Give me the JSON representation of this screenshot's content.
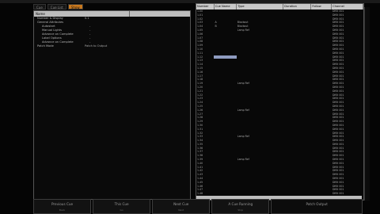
{
  "tabs": [
    "Cue",
    "Cue List",
    "Show"
  ],
  "props": {
    "header_name": "Name",
    "header_value": "",
    "rows": [
      {
        "k": "Number & Display",
        "v": "0.1"
      },
      {
        "k": "General Attributes",
        "v": ""
      },
      {
        "k": "Autostart",
        "v": "-"
      },
      {
        "k": "Manual Lights",
        "v": "-"
      },
      {
        "k": "Advance on Complete",
        "v": "-"
      },
      {
        "k": "Label Options",
        "v": "-"
      },
      {
        "k": "Advance on Complete",
        "v": "-"
      },
      {
        "k": "Patch Mode",
        "v": "Patch to Output"
      }
    ]
  },
  "cuelist": {
    "headers": [
      "Number",
      "Cue Name",
      "Type",
      "Duration",
      "Follow",
      "Channel"
    ],
    "rows": [
      {
        "n": "1.00",
        "a": "",
        "t": "",
        "ch": "DMX 001"
      },
      {
        "n": "1.01",
        "a": "",
        "t": "",
        "ch": "DMX 001"
      },
      {
        "n": "1.02",
        "a": "",
        "t": "",
        "ch": "DMX 001"
      },
      {
        "n": "1.03",
        "a": "A",
        "t": "Blackout",
        "ch": "DMX 001"
      },
      {
        "n": "1.04",
        "a": "B",
        "t": "Blackout",
        "ch": "DMX 001"
      },
      {
        "n": "1.05",
        "a": "",
        "t": "Lamp Ref",
        "ch": "DMX 001"
      },
      {
        "n": "1.06",
        "a": "",
        "t": "",
        "ch": "DMX 001"
      },
      {
        "n": "1.07",
        "a": "",
        "t": "",
        "ch": "DMX 001"
      },
      {
        "n": "1.08",
        "a": "",
        "t": "",
        "ch": "DMX 001"
      },
      {
        "n": "1.09",
        "a": "",
        "t": "",
        "ch": "DMX 001"
      },
      {
        "n": "1.10",
        "a": "",
        "t": "",
        "ch": "DMX 001"
      },
      {
        "n": "1.11",
        "a": "",
        "t": "",
        "ch": "DMX 001"
      },
      {
        "n": "1.12",
        "a": "",
        "t": "",
        "ch": "DMX 001"
      },
      {
        "n": "1.13",
        "a": "",
        "t": "",
        "ch": "DMX 001"
      },
      {
        "n": "1.14",
        "a": "",
        "t": "",
        "ch": "DMX 001"
      },
      {
        "n": "1.15",
        "a": "",
        "t": "",
        "ch": "DMX 001"
      },
      {
        "n": "1.16",
        "a": "",
        "t": "",
        "ch": "DMX 001"
      },
      {
        "n": "1.17",
        "a": "",
        "t": "",
        "ch": "DMX 001"
      },
      {
        "n": "1.18",
        "a": "",
        "t": "",
        "ch": "DMX 001"
      },
      {
        "n": "1.19",
        "a": "",
        "t": "Lamp Ref",
        "ch": "DMX 001"
      },
      {
        "n": "1.20",
        "a": "",
        "t": "",
        "ch": "DMX 001"
      },
      {
        "n": "1.21",
        "a": "",
        "t": "",
        "ch": "DMX 001"
      },
      {
        "n": "1.22",
        "a": "",
        "t": "",
        "ch": "DMX 001"
      },
      {
        "n": "1.23",
        "a": "",
        "t": "",
        "ch": "DMX 001"
      },
      {
        "n": "1.24",
        "a": "",
        "t": "",
        "ch": "DMX 001"
      },
      {
        "n": "1.25",
        "a": "",
        "t": "",
        "ch": "DMX 001"
      },
      {
        "n": "1.26",
        "a": "",
        "t": "Lamp Ref",
        "ch": "DMX 001"
      },
      {
        "n": "1.27",
        "a": "",
        "t": "",
        "ch": "DMX 001"
      },
      {
        "n": "1.28",
        "a": "",
        "t": "",
        "ch": "DMX 001"
      },
      {
        "n": "1.29",
        "a": "",
        "t": "",
        "ch": "DMX 001"
      },
      {
        "n": "1.30",
        "a": "",
        "t": "",
        "ch": "DMX 001"
      },
      {
        "n": "1.31",
        "a": "",
        "t": "",
        "ch": "DMX 001"
      },
      {
        "n": "1.32",
        "a": "",
        "t": "",
        "ch": "DMX 001"
      },
      {
        "n": "1.33",
        "a": "",
        "t": "Lamp Ref",
        "ch": "DMX 001"
      },
      {
        "n": "1.34",
        "a": "",
        "t": "",
        "ch": "DMX 001"
      },
      {
        "n": "1.35",
        "a": "",
        "t": "",
        "ch": "DMX 001"
      },
      {
        "n": "1.36",
        "a": "",
        "t": "",
        "ch": "DMX 001"
      },
      {
        "n": "1.37",
        "a": "",
        "t": "",
        "ch": "DMX 001"
      },
      {
        "n": "1.38",
        "a": "",
        "t": "",
        "ch": "DMX 001"
      },
      {
        "n": "1.39",
        "a": "",
        "t": "Lamp Ref",
        "ch": "DMX 001"
      },
      {
        "n": "1.40",
        "a": "",
        "t": "",
        "ch": "DMX 001"
      },
      {
        "n": "1.41",
        "a": "",
        "t": "",
        "ch": "DMX 001"
      },
      {
        "n": "1.42",
        "a": "",
        "t": "",
        "ch": "DMX 001"
      },
      {
        "n": "1.43",
        "a": "",
        "t": "",
        "ch": "DMX 001"
      },
      {
        "n": "1.44",
        "a": "",
        "t": "",
        "ch": "DMX 001"
      },
      {
        "n": "1.45",
        "a": "",
        "t": "",
        "ch": "DMX 001"
      },
      {
        "n": "1.46",
        "a": "",
        "t": "",
        "ch": "DMX 001"
      },
      {
        "n": "1.47",
        "a": "",
        "t": "",
        "ch": "DMX 001"
      },
      {
        "n": "1.48",
        "a": "",
        "t": "",
        "ch": "DMX 001"
      }
    ],
    "selected_index": 12
  },
  "buttons": [
    {
      "label": "Previous Cue",
      "sub": "Back"
    },
    {
      "label": "This Cue",
      "sub": "Go"
    },
    {
      "label": "Next Cue",
      "sub": "Next"
    },
    {
      "label": "A Cue Running",
      "sub": "Stop"
    },
    {
      "label": "Patch Output",
      "sub": ""
    }
  ]
}
